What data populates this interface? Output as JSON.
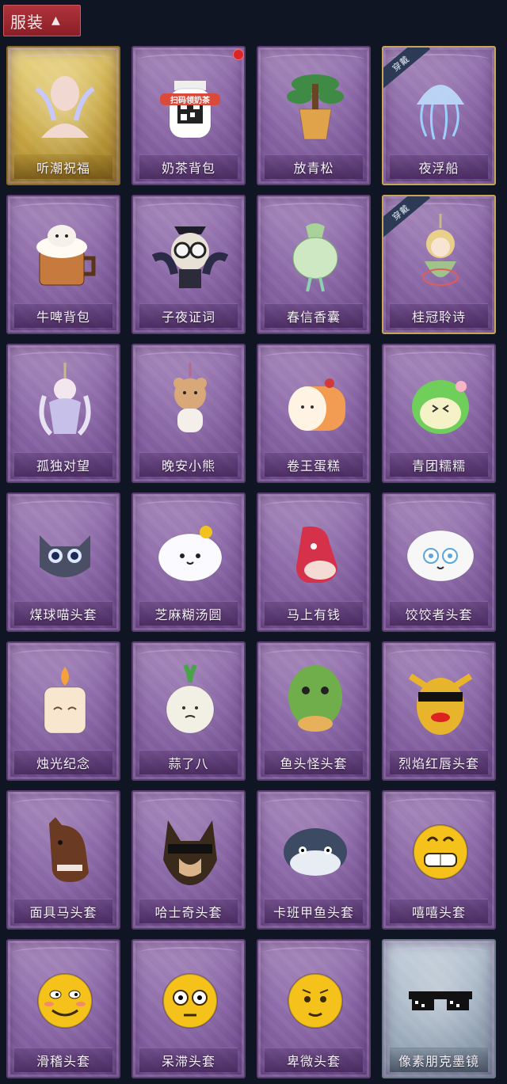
{
  "header": {
    "title": "服装",
    "toggle_icon": "chevron-up-icon"
  },
  "items": [
    {
      "name": "听潮祝福",
      "frame": "gold",
      "icon": "angel-bust-icon",
      "accent": "#f1d9d2"
    },
    {
      "name": "奶茶背包",
      "frame": "purple",
      "icon": "milk-tea-backpack-icon",
      "accent": "#ffffff",
      "new_dot": true,
      "qr_text": "扫码领奶茶"
    },
    {
      "name": "放青松",
      "frame": "purple",
      "icon": "potted-pine-icon",
      "accent": "#3f8b45"
    },
    {
      "name": "夜浮船",
      "frame": "purple",
      "icon": "jellyfish-icon",
      "accent": "#bfe3ff",
      "badge": "穿戴"
    },
    {
      "name": "牛啤背包",
      "frame": "purple",
      "icon": "cow-beer-mug-icon",
      "accent": "#c77a3e"
    },
    {
      "name": "子夜证词",
      "frame": "purple",
      "icon": "owl-figure-icon",
      "accent": "#2b2b3a"
    },
    {
      "name": "春信香囊",
      "frame": "purple",
      "icon": "scent-pouch-icon",
      "accent": "#cfe8c4"
    },
    {
      "name": "桂冠聆诗",
      "frame": "purple",
      "icon": "laurel-charm-icon",
      "accent": "#e9d08a",
      "badge": "穿戴"
    },
    {
      "name": "孤独对望",
      "frame": "purple",
      "icon": "charm-figure-icon",
      "accent": "#e7e2f3"
    },
    {
      "name": "晚安小熊",
      "frame": "purple",
      "icon": "teddy-bear-icon",
      "accent": "#d9a879"
    },
    {
      "name": "卷王蛋糕",
      "frame": "purple",
      "icon": "roll-cake-icon",
      "accent": "#f29b52"
    },
    {
      "name": "青团糯糯",
      "frame": "purple",
      "icon": "green-dumpling-icon",
      "accent": "#6fcf5a"
    },
    {
      "name": "煤球喵头套",
      "frame": "purple",
      "icon": "cat-head-icon",
      "accent": "#4a4f66"
    },
    {
      "name": "芝麻糊汤圆",
      "frame": "purple",
      "icon": "rice-ball-icon",
      "accent": "#ffffff"
    },
    {
      "name": "马上有钱",
      "frame": "purple",
      "icon": "horse-head-icon",
      "accent": "#d6314b"
    },
    {
      "name": "饺饺者头套",
      "frame": "purple",
      "icon": "dumpling-head-icon",
      "accent": "#f7f7f7"
    },
    {
      "name": "烛光纪念",
      "frame": "purple",
      "icon": "candle-icon",
      "accent": "#f9e6cf"
    },
    {
      "name": "蒜了八",
      "frame": "purple",
      "icon": "garlic-icon",
      "accent": "#f2efe5"
    },
    {
      "name": "鱼头怪头套",
      "frame": "purple",
      "icon": "fish-head-icon",
      "accent": "#6fae4a"
    },
    {
      "name": "烈焰红唇头套",
      "frame": "purple",
      "icon": "yellow-mask-icon",
      "accent": "#e8b42c"
    },
    {
      "name": "面具马头套",
      "frame": "purple",
      "icon": "brown-horse-icon",
      "accent": "#6b3a22"
    },
    {
      "name": "哈士奇头套",
      "frame": "purple",
      "icon": "dog-head-icon",
      "accent": "#3a2a1c"
    },
    {
      "name": "卡班甲鱼头套",
      "frame": "purple",
      "icon": "turtle-head-icon",
      "accent": "#3c4a63"
    },
    {
      "name": "嘻嘻头套",
      "frame": "purple",
      "icon": "grin-emoji-icon",
      "accent": "#f5c21b"
    },
    {
      "name": "滑稽头套",
      "frame": "purple",
      "icon": "smirk-emoji-icon",
      "accent": "#f5c21b"
    },
    {
      "name": "呆滞头套",
      "frame": "purple",
      "icon": "stare-emoji-icon",
      "accent": "#f5c21b"
    },
    {
      "name": "卑微头套",
      "frame": "purple",
      "icon": "humble-emoji-icon",
      "accent": "#f5c21b"
    },
    {
      "name": "像素朋克墨镜",
      "frame": "silver",
      "icon": "pixel-sunglasses-icon",
      "accent": "#111111"
    }
  ]
}
